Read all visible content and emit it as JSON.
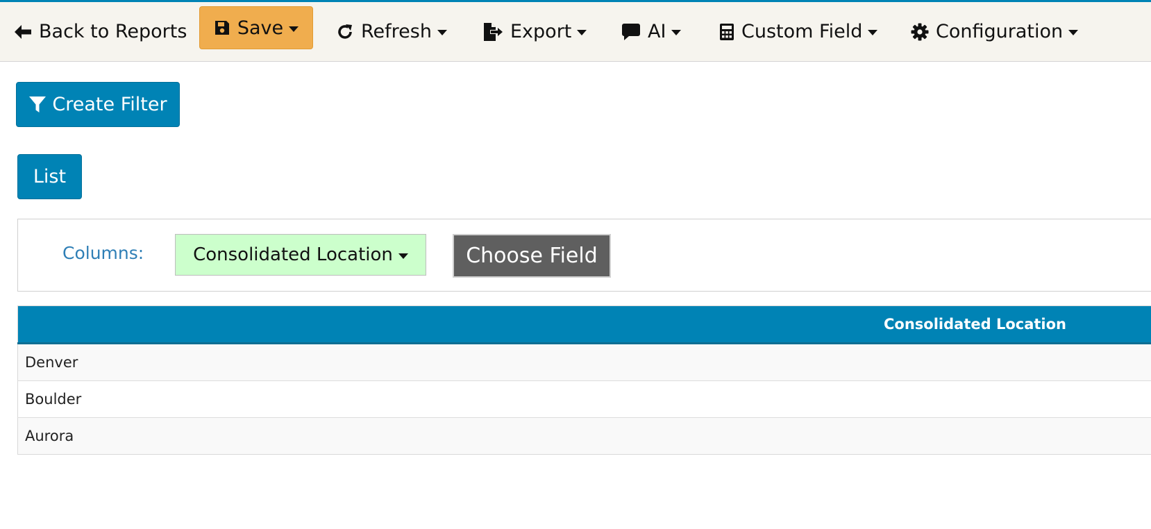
{
  "toolbar": {
    "back_label": "Back to Reports",
    "save_label": "Save",
    "refresh_label": "Refresh",
    "export_label": "Export",
    "ai_label": "AI",
    "custom_field_label": "Custom Field",
    "configuration_label": "Configuration",
    "icons": {
      "back": "arrow-left-icon",
      "save": "floppy-disk-icon",
      "refresh": "rotate-right-icon",
      "export": "file-export-icon",
      "ai": "speech-bubble-icon",
      "custom_field": "calculator-icon",
      "configuration": "gear-icon"
    }
  },
  "filter": {
    "create_filter_label": "Create Filter",
    "icon": "funnel-icon"
  },
  "view": {
    "list_label": "List"
  },
  "columns": {
    "label": "Columns:",
    "selected_column": "Consolidated Location",
    "choose_field_label": "Choose Field"
  },
  "table": {
    "headers": [
      "Consolidated Location"
    ],
    "rows": [
      [
        "Denver"
      ],
      [
        "Boulder"
      ],
      [
        "Aurora"
      ]
    ]
  },
  "colors": {
    "accent": "#0083b5",
    "save_button": "#f0ad4e",
    "column_chip": "#ccffcc",
    "choose_field": "#5f5f5f",
    "columns_label": "#2f7fb6"
  }
}
